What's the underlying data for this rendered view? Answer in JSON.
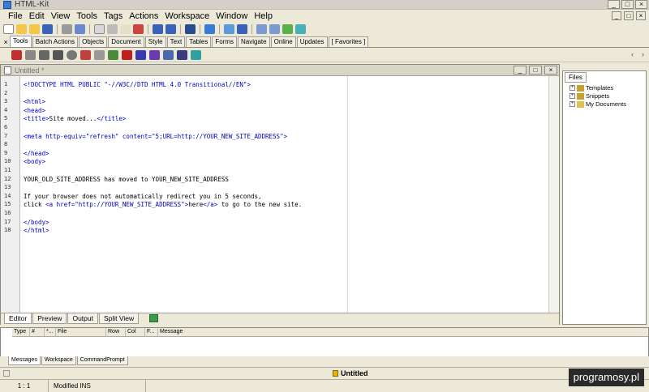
{
  "window": {
    "title": "HTML-Kit",
    "min": "_",
    "max": "□",
    "close": "×"
  },
  "menu": [
    "File",
    "Edit",
    "View",
    "Tools",
    "Tags",
    "Actions",
    "Workspace",
    "Window",
    "Help"
  ],
  "toolbar_tabs": [
    "Tools",
    "Batch Actions",
    "Objects",
    "Document",
    "Style",
    "Text",
    "Tables",
    "Forms",
    "Navigate",
    "Online",
    "Updates",
    "[ Favorites ]"
  ],
  "toolbar_tabs_close": "×",
  "toolbar2": {
    "left_arrow": "‹",
    "right_arrow": "›"
  },
  "editor": {
    "title": "Untitled *",
    "line_numbers": [
      "1",
      "2",
      "3",
      "4",
      "5",
      "6",
      "7",
      "8",
      "9",
      "10",
      "11",
      "12",
      "13",
      "14",
      "15",
      "16",
      "17",
      "18"
    ],
    "lines": [
      "<!DOCTYPE HTML PUBLIC \"-//W3C//DTD HTML 4.0 Transitional//EN\">",
      "",
      "<html>",
      "<head>",
      "<title>Site moved...</title>",
      "",
      "<meta http-equiv=\"refresh\" content=\"5;URL=http://YOUR_NEW_SITE_ADDRESS\">",
      "",
      "</head>",
      "<body>",
      "",
      "YOUR_OLD_SITE_ADDRESS has moved to YOUR_NEW_SITE_ADDRESS",
      "",
      "If your browser does not automatically redirect you in 5 seconds,",
      "click <a href=\"http://YOUR_NEW_SITE_ADDRESS\">here</a> to go to the new site.",
      "",
      "</body>",
      "</html>"
    ],
    "tabs": [
      "Editor",
      "Preview",
      "Output",
      "Split View"
    ]
  },
  "files": {
    "tab": "Files",
    "items": [
      "Templates",
      "Snippets",
      "My Documents"
    ]
  },
  "messages": {
    "columns": [
      "Type",
      "#",
      "*...",
      "File",
      "Row",
      "Col",
      "F...",
      "Message"
    ],
    "tabs": [
      "Messages",
      "Workspace",
      "CommandPrompt"
    ]
  },
  "status": {
    "document": "Untitled",
    "position": "1 : 1",
    "mode": "Modified INS"
  },
  "watermark": "programosy.pl"
}
